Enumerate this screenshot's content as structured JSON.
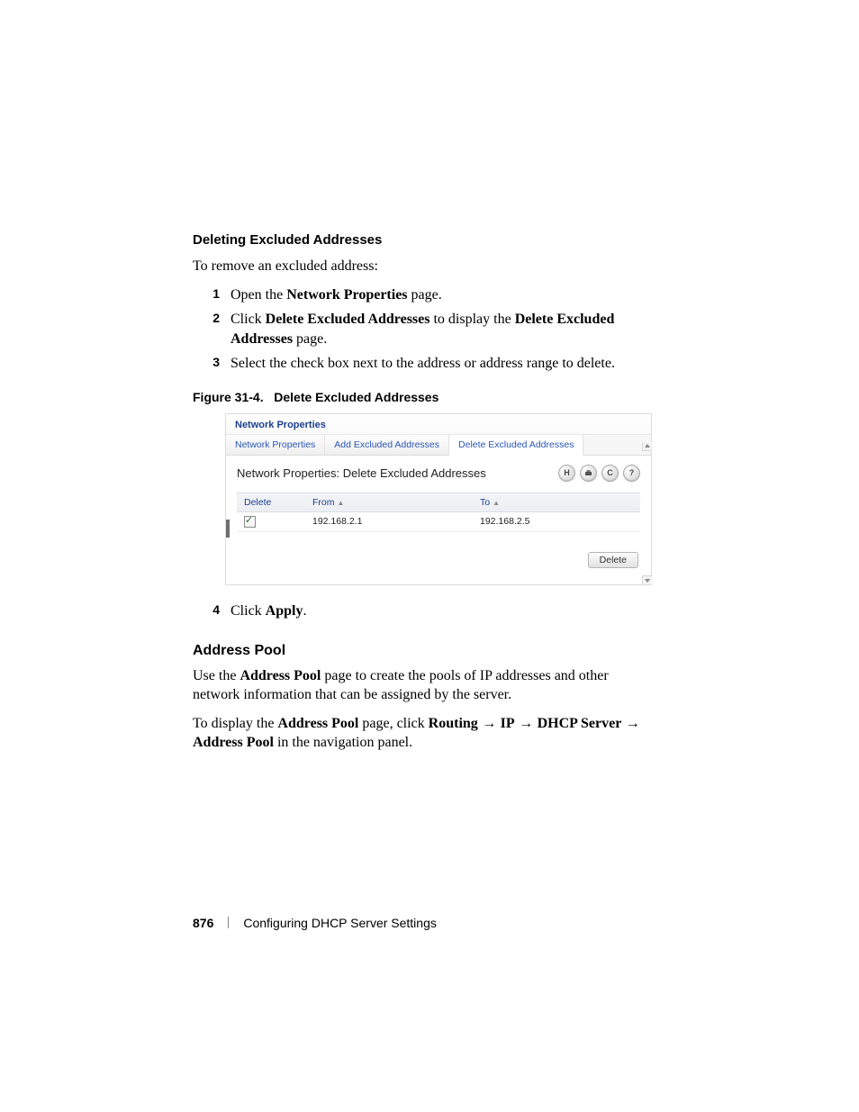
{
  "section_heading": "Deleting Excluded Addresses",
  "intro_line": "To remove an excluded address:",
  "steps": [
    {
      "num": "1",
      "pre": "Open the ",
      "bold": "Network Properties",
      "post": " page."
    },
    {
      "num": "2",
      "pre": "Click ",
      "bold": "Delete Excluded Addresses",
      "mid": " to display the ",
      "bold2": "Delete Excluded Addresses",
      "post": " page."
    },
    {
      "num": "3",
      "pre": "Select the check box next to the address or address range to delete.",
      "bold": "",
      "post": ""
    }
  ],
  "figure_caption_num": "Figure 31-4.",
  "figure_caption_text": "Delete Excluded Addresses",
  "screenshot": {
    "titlebar": "Network Properties",
    "tabs": [
      {
        "label": "Network Properties",
        "active": false
      },
      {
        "label": "Add Excluded Addresses",
        "active": false
      },
      {
        "label": "Delete Excluded Addresses",
        "active": true
      }
    ],
    "heading": "Network Properties: Delete Excluded Addresses",
    "icons": [
      "H",
      "",
      "C",
      "?"
    ],
    "icon_names": [
      "save-icon",
      "print-icon",
      "refresh-icon",
      "help-icon"
    ],
    "table": {
      "headers": [
        "Delete",
        "From",
        "To"
      ],
      "row": {
        "from": "192.168.2.1",
        "to": "192.168.2.5",
        "checked": true
      }
    },
    "delete_button": "Delete"
  },
  "step4": {
    "num": "4",
    "pre": "Click ",
    "bold": "Apply",
    "post": "."
  },
  "address_pool": {
    "heading": "Address Pool",
    "para1_pre": "Use the ",
    "para1_bold": "Address Pool",
    "para1_post": " page to create the pools of IP addresses and other network information that can be assigned by the server.",
    "para2_parts": {
      "pre": "To display the ",
      "b1": "Address Pool",
      "mid1": " page, click ",
      "b2": "Routing",
      "arrow": " → ",
      "b3": "IP",
      "b4": "DHCP Server",
      "end_pre": " → ",
      "b5": "Address Pool",
      "tail": " in the navigation panel."
    }
  },
  "footer": {
    "page": "876",
    "title": "Configuring DHCP Server Settings"
  }
}
